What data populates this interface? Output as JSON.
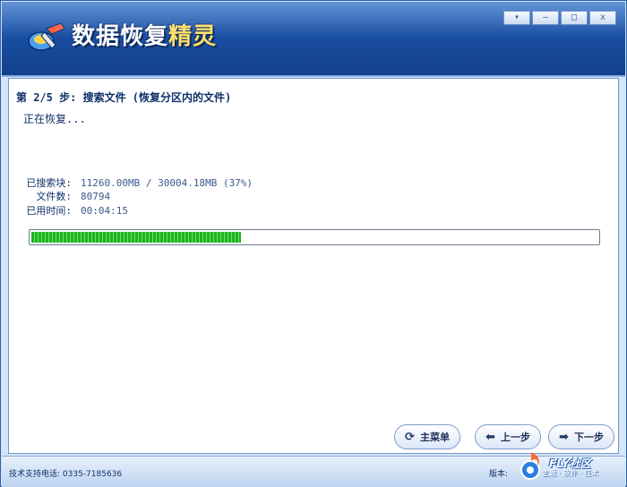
{
  "app": {
    "title_main": "数据恢复",
    "title_accent": "精灵"
  },
  "window_controls": {
    "menu": "▾",
    "minimize": "—",
    "maximize": "□",
    "close": "x"
  },
  "step": {
    "title": "第 2/5 步: 搜索文件 (恢复分区内的文件)",
    "status": "正在恢复..."
  },
  "stats": {
    "searched_label": "已搜索块:",
    "searched_value": "11260.00MB / 30004.18MB (37%)",
    "files_label": "文件数:",
    "files_value": "80794",
    "elapsed_label": "已用时间:",
    "elapsed_value": "00:04:15"
  },
  "progress": {
    "fraction": 0.37
  },
  "buttons": {
    "main_menu": "主菜单",
    "prev": "上一步",
    "next": "下一步"
  },
  "footer": {
    "support": "技术支持电话: 0335-7185636",
    "version_label": "版本:",
    "watermark": "FLY社区",
    "watermark_sub": "主题 · 软件 · 技术"
  },
  "colors": {
    "accent_blue": "#1a4fa3",
    "progress_green": "#1fb31f",
    "title_yellow": "#ffe066"
  },
  "icons": {
    "main_menu": "refresh-icon",
    "prev": "arrow-left-icon",
    "next": "arrow-right-icon"
  }
}
